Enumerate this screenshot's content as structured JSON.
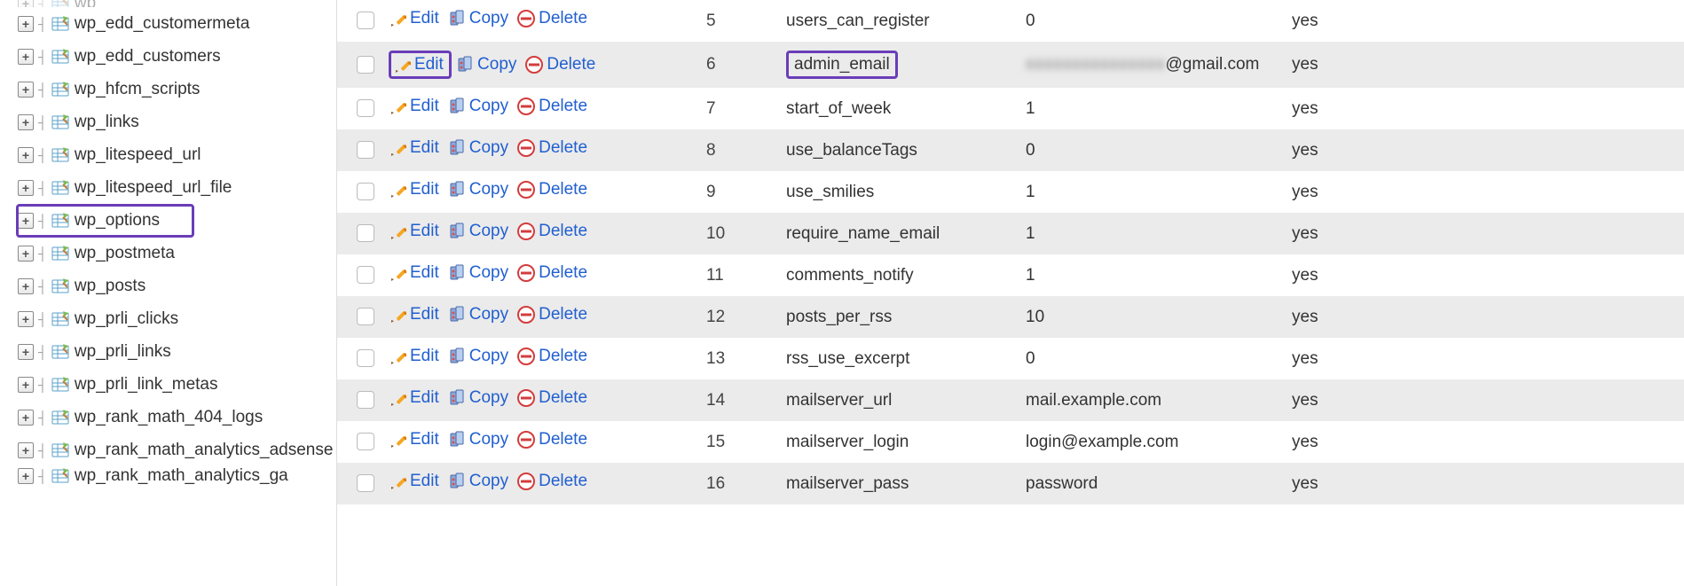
{
  "sidebar": {
    "items": [
      {
        "label": "wp_"
      },
      {
        "label": "wp_edd_customermeta"
      },
      {
        "label": "wp_edd_customers"
      },
      {
        "label": "wp_hfcm_scripts"
      },
      {
        "label": "wp_links"
      },
      {
        "label": "wp_litespeed_url"
      },
      {
        "label": "wp_litespeed_url_file"
      },
      {
        "label": "wp_options",
        "highlighted": true
      },
      {
        "label": "wp_postmeta"
      },
      {
        "label": "wp_posts"
      },
      {
        "label": "wp_prli_clicks"
      },
      {
        "label": "wp_prli_links"
      },
      {
        "label": "wp_prli_link_metas"
      },
      {
        "label": "wp_rank_math_404_logs"
      },
      {
        "label": "wp_rank_math_analytics_adsense"
      },
      {
        "label": "wp_rank_math_analytics_ga"
      }
    ]
  },
  "actions": {
    "edit": "Edit",
    "copy": "Copy",
    "delete": "Delete"
  },
  "rows": [
    {
      "id": "5",
      "name": "users_can_register",
      "value": "0",
      "autoload": "yes",
      "value_obscured": false,
      "highlighted": false
    },
    {
      "id": "6",
      "name": "admin_email",
      "value": "@gmail.com",
      "autoload": "yes",
      "value_obscured": true,
      "highlighted": true
    },
    {
      "id": "7",
      "name": "start_of_week",
      "value": "1",
      "autoload": "yes",
      "value_obscured": false,
      "highlighted": false
    },
    {
      "id": "8",
      "name": "use_balanceTags",
      "value": "0",
      "autoload": "yes",
      "value_obscured": false,
      "highlighted": false
    },
    {
      "id": "9",
      "name": "use_smilies",
      "value": "1",
      "autoload": "yes",
      "value_obscured": false,
      "highlighted": false
    },
    {
      "id": "10",
      "name": "require_name_email",
      "value": "1",
      "autoload": "yes",
      "value_obscured": false,
      "highlighted": false
    },
    {
      "id": "11",
      "name": "comments_notify",
      "value": "1",
      "autoload": "yes",
      "value_obscured": false,
      "highlighted": false
    },
    {
      "id": "12",
      "name": "posts_per_rss",
      "value": "10",
      "autoload": "yes",
      "value_obscured": false,
      "highlighted": false
    },
    {
      "id": "13",
      "name": "rss_use_excerpt",
      "value": "0",
      "autoload": "yes",
      "value_obscured": false,
      "highlighted": false
    },
    {
      "id": "14",
      "name": "mailserver_url",
      "value": "mail.example.com",
      "autoload": "yes",
      "value_obscured": false,
      "highlighted": false
    },
    {
      "id": "15",
      "name": "mailserver_login",
      "value": "login@example.com",
      "autoload": "yes",
      "value_obscured": false,
      "highlighted": false
    },
    {
      "id": "16",
      "name": "mailserver_pass",
      "value": "password",
      "autoload": "yes",
      "value_obscured": false,
      "highlighted": false
    }
  ],
  "colors": {
    "link": "#215fd0",
    "highlight": "#6a3db8"
  }
}
